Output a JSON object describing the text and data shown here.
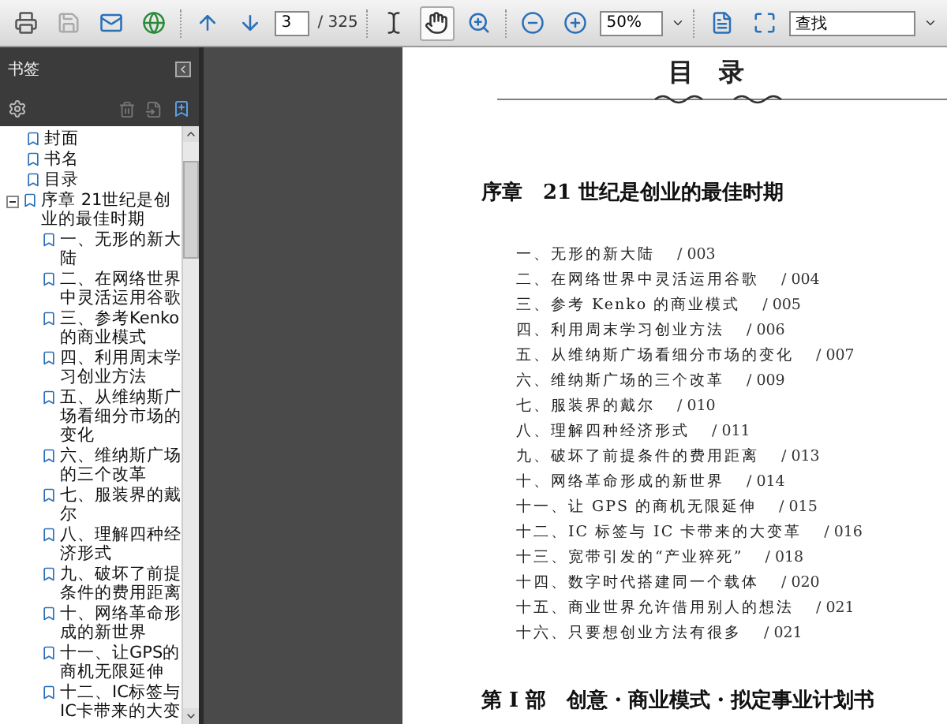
{
  "toolbar": {
    "save": {
      "disabled": true
    },
    "page_field": "3",
    "page_count": "/ 325",
    "hand_tool": {
      "selected": true
    },
    "zoom_field": "50%",
    "search_field": "查找"
  },
  "bookmarks": {
    "title": "书签",
    "items": [
      {
        "label": "封面"
      },
      {
        "label": "书名"
      },
      {
        "label": "目录"
      },
      {
        "label": "序章  21世纪是创业的最佳时期",
        "expanded": true,
        "children": [
          {
            "label": "一、无形的新大陆"
          },
          {
            "label": "二、在网络世界中灵活运用谷歌"
          },
          {
            "label": "三、参考Kenko的商业模式"
          },
          {
            "label": "四、利用周末学习创业方法"
          },
          {
            "label": "五、从维纳斯广场看细分市场的变化"
          },
          {
            "label": "六、维纳斯广场的三个改革"
          },
          {
            "label": "七、服装界的戴尔"
          },
          {
            "label": "八、理解四种经济形式"
          },
          {
            "label": "九、破坏了前提条件的费用距离"
          },
          {
            "label": "十、网络革命形成的新世界"
          },
          {
            "label": "十一、让GPS的商机无限延伸"
          },
          {
            "label": "十二、IC标签与IC卡带来的大变"
          }
        ]
      }
    ]
  },
  "page": {
    "title": "目　录",
    "chapter": "序章　21 世纪是创业的最佳时期",
    "entries": [
      {
        "text": "一、无形的新大陆",
        "page": "/ 003"
      },
      {
        "text": "二、在网络世界中灵活运用谷歌",
        "page": "/ 004"
      },
      {
        "text": "三、参考 Kenko 的商业模式",
        "page": "/ 005"
      },
      {
        "text": "四、利用周末学习创业方法",
        "page": "/ 006"
      },
      {
        "text": "五、从维纳斯广场看细分市场的变化",
        "page": "/ 007"
      },
      {
        "text": "六、维纳斯广场的三个改革",
        "page": "/ 009"
      },
      {
        "text": "七、服装界的戴尔",
        "page": "/ 010"
      },
      {
        "text": "八、理解四种经济形式",
        "page": "/ 011"
      },
      {
        "text": "九、破坏了前提条件的费用距离",
        "page": "/ 013"
      },
      {
        "text": "十、网络革命形成的新世界",
        "page": "/ 014"
      },
      {
        "text": "十一、让 GPS 的商机无限延伸",
        "page": "/ 015"
      },
      {
        "text": "十二、IC 标签与 IC 卡带来的大变革",
        "page": "/ 016"
      },
      {
        "text": "十三、宽带引发的“产业猝死”",
        "page": "/ 018"
      },
      {
        "text": "十四、数字时代搭建同一个载体",
        "page": "/ 020"
      },
      {
        "text": "十五、商业世界允许借用别人的想法",
        "page": "/ 021"
      },
      {
        "text": "十六、只要想创业方法有很多",
        "page": "/ 021"
      }
    ],
    "part": "第 I 部　创意・商业模式・拟定事业计划书"
  }
}
